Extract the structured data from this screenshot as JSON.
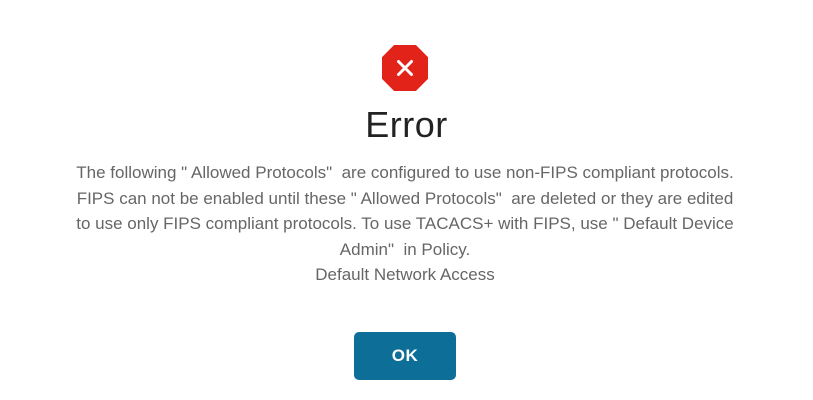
{
  "dialog": {
    "icon": "error-octagon-icon",
    "icon_color": "#e2231a",
    "title": "Error",
    "message_lines": [
      "The following \" Allowed Protocols\"  are configured to use non-FIPS compliant protocols.",
      "FIPS can not be enabled until these \" Allowed Protocols\"  are deleted or they are edited",
      "to use only FIPS compliant protocols. To use TACACS+ with FIPS, use \" Default Device",
      "Admin\"  in Policy.",
      "Default Network Access"
    ],
    "ok_label": "OK",
    "button_color": "#0d6f98"
  }
}
